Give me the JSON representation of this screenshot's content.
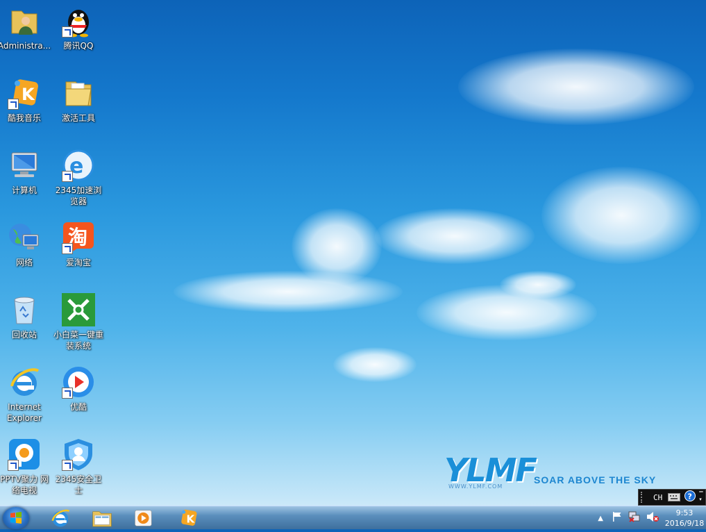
{
  "desktop": {
    "icons": [
      {
        "label": "Administra...",
        "icon": "user-folder-icon"
      },
      {
        "label": "腾讯QQ",
        "icon": "qq-penguin-icon"
      },
      {
        "label": "酷我音乐",
        "icon": "kuwo-music-icon"
      },
      {
        "label": "激活工具",
        "icon": "folder-icon"
      },
      {
        "label": "计算机",
        "icon": "computer-icon"
      },
      {
        "label": "2345加速浏览器",
        "icon": "browser-2345-icon"
      },
      {
        "label": "网络",
        "icon": "network-icon"
      },
      {
        "label": "爱淘宝",
        "icon": "taobao-icon"
      },
      {
        "label": "回收站",
        "icon": "recycle-bin-icon"
      },
      {
        "label": "小白菜一键重装系统",
        "icon": "reinstall-system-icon"
      },
      {
        "label": "Internet Explorer",
        "icon": "internet-explorer-icon"
      },
      {
        "label": "优酷",
        "icon": "youku-icon"
      },
      {
        "label": "PPTV聚力 网络电视",
        "icon": "pptv-icon"
      },
      {
        "label": "2345安全卫士",
        "icon": "security-shield-icon"
      }
    ]
  },
  "wallpaper": {
    "brand": "YLMF",
    "url": "WWW.YLMF.COM",
    "slogan": "SOAR ABOVE THE SKY"
  },
  "langbar": {
    "lang": "CH"
  },
  "taskbar": {
    "pinned": [
      "internet-explorer-icon",
      "windows-explorer-icon",
      "media-player-icon",
      "kuwo-music-icon"
    ]
  },
  "tray": {
    "time": "9:53",
    "date": "2016/9/18"
  },
  "colors": {
    "taskbar": "#3e6f9d",
    "sky": "#1478cc"
  }
}
